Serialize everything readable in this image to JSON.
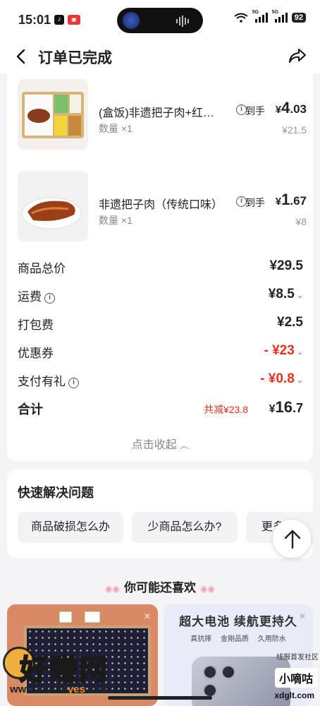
{
  "status_bar": {
    "time": "15:01",
    "battery": "92",
    "network": "5G"
  },
  "nav": {
    "title": "订单已完成"
  },
  "order": {
    "items": [
      {
        "name": "(盒饭)非遗把子肉+红…",
        "qty": "数量 ×1",
        "price_label": "到手",
        "currency": "¥",
        "price_int": "4",
        "price_dec": ".03",
        "orig_price": "¥21.5"
      },
      {
        "name": "非遗把子肉（传统口味）",
        "qty": "数量 ×1",
        "price_label": "到手",
        "currency": "¥",
        "price_int": "1",
        "price_dec": ".67",
        "orig_price": "¥8"
      }
    ],
    "summary": [
      {
        "label": "商品总价",
        "value": "¥29.5",
        "info": false,
        "chevron": false,
        "red": false
      },
      {
        "label": "运费",
        "value": "¥8.5",
        "info": true,
        "chevron": true,
        "red": false
      },
      {
        "label": "打包费",
        "value": "¥2.5",
        "info": false,
        "chevron": false,
        "red": false
      },
      {
        "label": "优惠券",
        "value": "- ¥23",
        "info": false,
        "chevron": true,
        "red": true
      },
      {
        "label": "支付有礼",
        "value": "- ¥0.8",
        "info": true,
        "chevron": true,
        "red": true
      }
    ],
    "total": {
      "label": "合计",
      "discount": "共减¥23.8",
      "currency": "¥",
      "int": "16",
      "dec": ".7"
    },
    "collapse_label": "点击收起"
  },
  "help": {
    "title": "快速解决问题",
    "chips": [
      "商品破损怎么办",
      "少商品怎么办?",
      "更多"
    ]
  },
  "recommend": {
    "title": "你可能还喜欢",
    "ad": {
      "headline": "超大电池 续航更持久",
      "features": "真抗摔 金刚品质 久用防水"
    }
  },
  "watermarks": {
    "left_big": "好赚网",
    "left_url_a": "www.zhuan",
    "left_url_b": "yes",
    "left_url_c": ".com",
    "right_top": "线报首发社区",
    "right_name": "小嘀咕",
    "right_url": "xdglt.com"
  },
  "colors": {
    "accent_red": "#e8301f",
    "background": "#f4f4f6"
  }
}
